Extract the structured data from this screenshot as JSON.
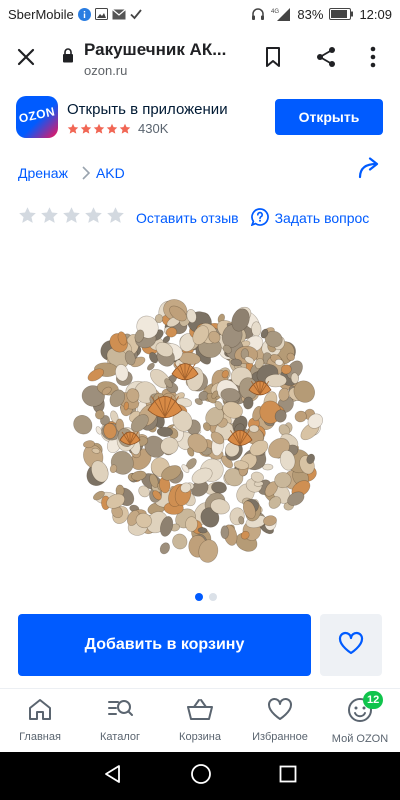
{
  "status_bar": {
    "carrier": "SberMobile",
    "battery": "83%",
    "time": "12:09",
    "network": "4G"
  },
  "browser": {
    "page_title": "Ракушечник АК...",
    "url": "ozon.ru"
  },
  "app_banner": {
    "title": "Открыть в приложении",
    "logo_text": "OZON",
    "rating_stars": 5,
    "rating_count": "430K",
    "open_label": "Открыть"
  },
  "breadcrumb": {
    "items": [
      "Дренаж",
      "AKD"
    ]
  },
  "product": {
    "rating_value": 0,
    "review_label": "Оставить отзыв",
    "question_label": "Задать вопрос",
    "image_count": 2,
    "current_image": 1
  },
  "actions": {
    "add_to_cart_label": "Добавить в корзину"
  },
  "bottom_nav": {
    "items": [
      {
        "label": "Главная",
        "icon": "home-icon"
      },
      {
        "label": "Каталог",
        "icon": "catalog-search-icon"
      },
      {
        "label": "Корзина",
        "icon": "basket-icon"
      },
      {
        "label": "Избранное",
        "icon": "heart-icon"
      },
      {
        "label": "Мой OZON",
        "icon": "profile-smile-icon",
        "badge": "12"
      }
    ]
  },
  "colors": {
    "brand_blue": "#005bff",
    "brand_pink": "#f91155",
    "banner_stars": "#f16654",
    "empty_stars": "#d3d9e0",
    "badge_green": "#10c44c"
  }
}
